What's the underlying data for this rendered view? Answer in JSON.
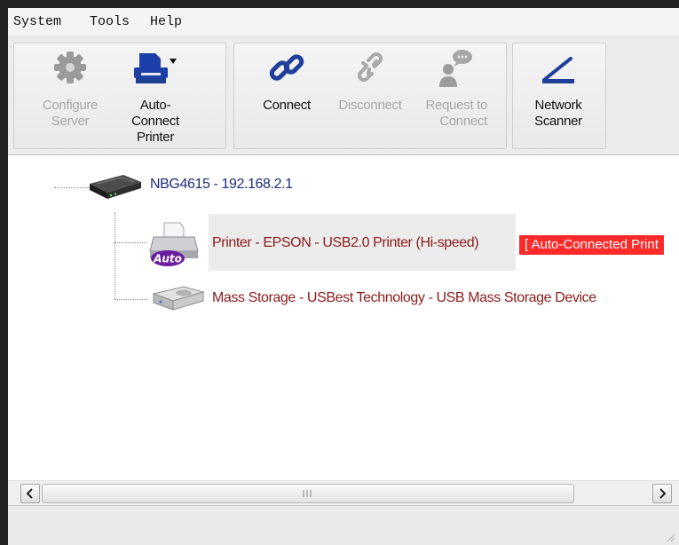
{
  "menu": {
    "items": [
      "System",
      "Tools",
      "Help"
    ]
  },
  "toolbar": {
    "buttons": [
      {
        "label": "Configure\nServer",
        "icon": "gear-icon",
        "enabled": false
      },
      {
        "label": "Auto-Connect\nPrinter",
        "icon": "printer-dropdown-icon",
        "enabled": true
      },
      {
        "label": "Connect",
        "icon": "chain-link-icon",
        "enabled": true
      },
      {
        "label": "Disconnect",
        "icon": "broken-link-icon",
        "enabled": false
      },
      {
        "label": "Request to\nConnect",
        "icon": "user-chat-icon",
        "enabled": false
      },
      {
        "label": "Network\nScanner",
        "icon": "scanner-icon",
        "enabled": true
      }
    ]
  },
  "tree": {
    "router": {
      "label": "NBG4615 - 192.168.2.1",
      "icon": "router-icon"
    },
    "devices": [
      {
        "label": "Printer - EPSON - USB2.0 Printer (Hi-speed)",
        "badge": "[ Auto-Connected Print",
        "icon": "auto-printer-icon",
        "icon_overlay_text": "Auto",
        "selected": true
      },
      {
        "label": "Mass Storage - USBest Technology - USB Mass Storage Device",
        "icon": "mass-storage-icon",
        "selected": false
      }
    ]
  },
  "colors": {
    "router_text": "#1b2d7a",
    "device_text": "#8b1b1b",
    "badge_bg": "#ff2a2a",
    "link_icon": "#1f3f9a"
  }
}
